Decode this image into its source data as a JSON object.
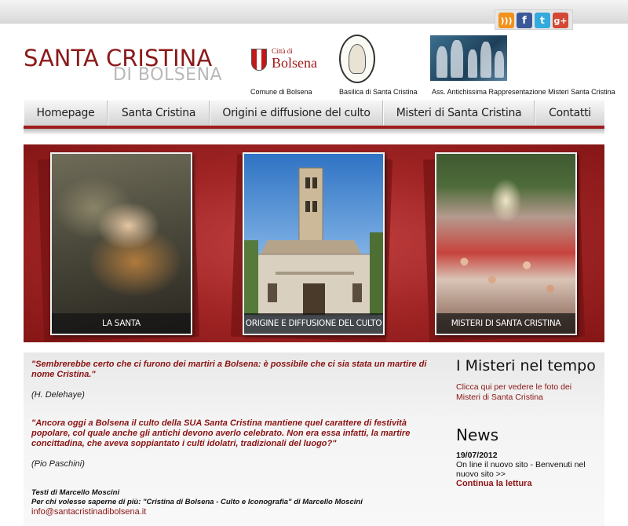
{
  "social": {
    "icons": [
      "rss-icon",
      "facebook-icon",
      "twitter-icon",
      "google-plus-icon"
    ],
    "glyphs": {
      "rss": ")))",
      "facebook": "f",
      "twitter": "t",
      "googleplus": "g+"
    }
  },
  "header": {
    "logo_title": "SANTA CRISTINA",
    "logo_subtitle": "DI BOLSENA",
    "partners": [
      {
        "logo_small": "Città di",
        "logo_big": "Bolsena",
        "caption": "Comune di Bolsena"
      },
      {
        "caption": "Basilica di Santa Cristina"
      },
      {
        "caption": "Ass. Antichissima Rappresentazione Misteri Santa Cristina"
      }
    ]
  },
  "nav": {
    "items": [
      {
        "label": "Homepage"
      },
      {
        "label": "Santa Cristina"
      },
      {
        "label": "Origini e diffusione del culto"
      },
      {
        "label": "Misteri di Santa Cristina"
      },
      {
        "label": "Contatti"
      }
    ]
  },
  "hero": {
    "cards": [
      {
        "caption": "LA SANTA"
      },
      {
        "caption": "ORIGINE E DIFFUSIONE DEL CULTO"
      },
      {
        "caption": "MISTERI DI SANTA CRISTINA"
      }
    ]
  },
  "main": {
    "quote1": "\"Sembrerebbe certo che ci furono dei martiri a Bolsena: è possibile che ci sia stata un martire di nome Cristina.\"",
    "author1": "(H. Delehaye)",
    "quote2": "\"Ancora oggi a Bolsena il culto della SUA Santa Cristina mantiene quel carattere di festività popolare, col quale anche gli antichi devono averlo celebrato. Non era essa infatti, la martire concittadina, che aveva soppiantato i culti idolatri, tradizionali del luogo?\"",
    "author2": "(Pio Paschini)",
    "credits_line1": "Testi di Marcello Moscini",
    "credits_line2": "Per chi volesse saperne di più: \"Cristina di Bolsena - Culto e Iconografia\" di Marcello Moscini",
    "email": "info@santacristinadibolsena.it"
  },
  "sidebar": {
    "misteri_title": "I Misteri nel tempo",
    "misteri_link": "Clicca qui per vedere le foto dei Misteri di Santa Cristina",
    "news_title": "News",
    "news_date": "19/07/2012",
    "news_text": "On line il nuovo sito - Benvenuti nel nuovo sito >>",
    "news_more": "Continua la lettura"
  }
}
